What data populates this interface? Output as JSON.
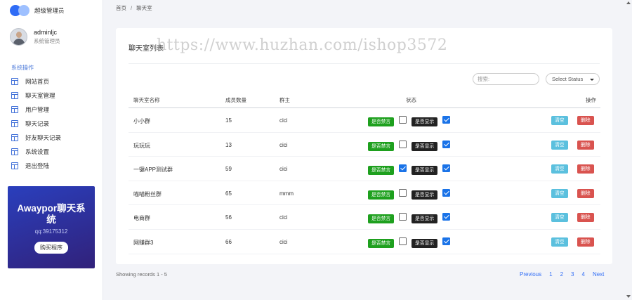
{
  "brand": {
    "title": "超级管理员"
  },
  "profile": {
    "name": "adminljc",
    "role": "系统管理员"
  },
  "menu": {
    "title": "系统操作",
    "items": [
      "网站首页",
      "聊天室管理",
      "用户管理",
      "聊天记录",
      "好友聊天记录",
      "系统设置",
      "退出登陆"
    ]
  },
  "promo": {
    "title": "Awaypor聊天系统",
    "qq": "qq:39175312",
    "button": "购买程序"
  },
  "breadcrumb": {
    "home": "首页",
    "sep": "/",
    "current": "聊天室"
  },
  "card": {
    "title": "聊天室列表",
    "watermark": "https://www.huzhan.com/ishop3572",
    "search_placeholder": "搜索:",
    "status_select": "Select Status"
  },
  "table": {
    "headers": {
      "name": "聊天室名称",
      "members": "成员数量",
      "owner": "群主",
      "status": "状态",
      "actions": "操作"
    },
    "mute_label": "是否禁言",
    "show_label": "是否显示",
    "clear_label": "清空",
    "delete_label": "删除",
    "rows": [
      {
        "name": "小小群",
        "members": "15",
        "owner": "cici",
        "muted": false,
        "shown": true
      },
      {
        "name": "玩玩玩",
        "members": "13",
        "owner": "cici",
        "muted": false,
        "shown": true
      },
      {
        "name": "一键APP测试群",
        "members": "59",
        "owner": "cici",
        "muted": true,
        "shown": true
      },
      {
        "name": "喵喵粉丝群",
        "members": "65",
        "owner": "mmm",
        "muted": false,
        "shown": true
      },
      {
        "name": "电商群",
        "members": "56",
        "owner": "cici",
        "muted": false,
        "shown": true
      },
      {
        "name": "网赚群3",
        "members": "66",
        "owner": "cici",
        "muted": false,
        "shown": true
      }
    ]
  },
  "footer": {
    "records": "Showing records 1 - 5",
    "pagination": {
      "previous": "Previous",
      "pages": [
        "1",
        "2",
        "3",
        "4"
      ],
      "next": "Next"
    }
  }
}
